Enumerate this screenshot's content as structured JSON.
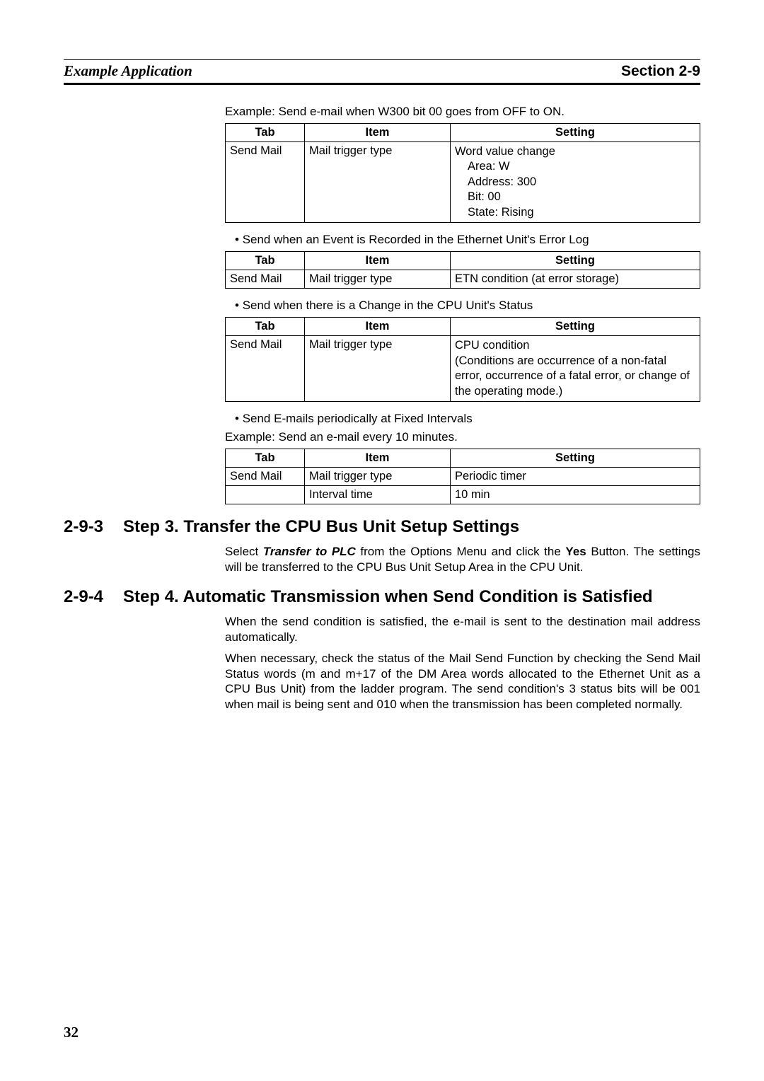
{
  "header": {
    "left": "Example Application",
    "right": "Section 2-9"
  },
  "example1": "Example: Send e-mail when W300 bit 00 goes from OFF to ON.",
  "table_headers": {
    "tab": "Tab",
    "item": "Item",
    "setting": "Setting"
  },
  "table1": {
    "tab": "Send Mail",
    "item": "Mail trigger type",
    "setting_line1": "Word value change",
    "setting_area": "Area: W",
    "setting_address": "Address: 300",
    "setting_bit": "Bit: 00",
    "setting_state": "State: Rising"
  },
  "bullet2": "Send when an Event is Recorded in the Ethernet Unit's Error Log",
  "table2": {
    "tab": "Send Mail",
    "item": "Mail trigger type",
    "setting": "ETN condition (at error storage)"
  },
  "bullet3": "Send when there is a Change in the CPU Unit's Status",
  "table3": {
    "tab": "Send Mail",
    "item": "Mail trigger type",
    "setting": "CPU condition\n(Conditions are occurrence of a non-fatal error, occurrence of a fatal error, or change of the operating mode.)"
  },
  "bullet4": "Send E-mails periodically at Fixed Intervals",
  "example4": "Example: Send an e-mail every 10 minutes.",
  "table4": {
    "row1": {
      "tab": "Send Mail",
      "item": "Mail trigger type",
      "setting": "Periodic timer"
    },
    "row2": {
      "tab": "",
      "item": "Interval time",
      "setting": "10 min"
    }
  },
  "section293": {
    "num": "2-9-3",
    "title": "Step 3. Transfer the CPU Bus Unit Setup Settings",
    "para_pre": "Select ",
    "para_bold1": "Transfer to PLC",
    "para_mid": " from the Options Menu and click the ",
    "para_bold2": "Yes",
    "para_post": " Button. The settings will be transferred to the CPU Bus Unit Setup Area in the CPU Unit."
  },
  "section294": {
    "num": "2-9-4",
    "title": "Step 4. Automatic Transmission when Send Condition is Satisfied",
    "para1": "When the send condition is satisfied, the e-mail is sent to the destination mail address automatically.",
    "para2": "When necessary, check the status of the Mail Send Function by checking the Send Mail Status words (m and m+17 of the DM Area words allocated to the Ethernet Unit as a CPU Bus Unit) from the ladder program. The send condition's 3 status bits will be 001 when mail is being sent and 010 when the transmission has been completed normally."
  },
  "page_number": "32"
}
